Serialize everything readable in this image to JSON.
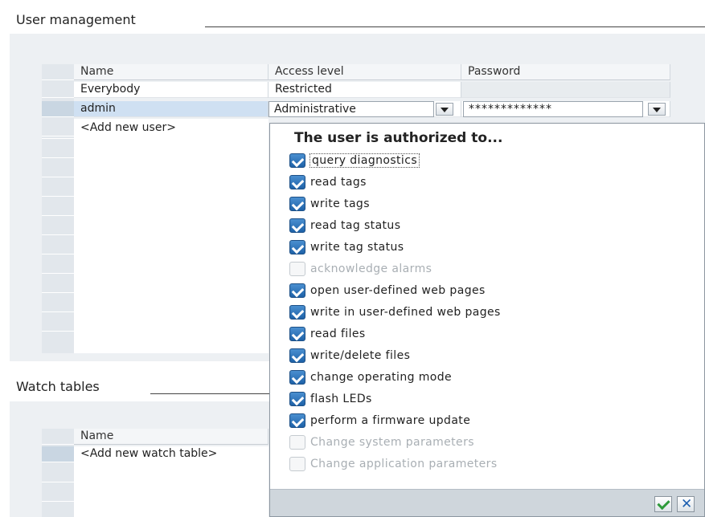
{
  "user_management": {
    "title": "User management",
    "columns": {
      "name": "Name",
      "access_level": "Access level",
      "password": "Password"
    },
    "rows": [
      {
        "name": "Everybody",
        "access_level": "Restricted",
        "password": ""
      },
      {
        "name": "admin",
        "access_level": "Administrative",
        "password": "*************"
      }
    ],
    "add_new": "<Add new user>"
  },
  "watch_tables": {
    "title": "Watch tables",
    "columns": {
      "name": "Name"
    },
    "add_new": "<Add new watch table>"
  },
  "permissions_popup": {
    "title": "The user is authorized to...",
    "items": [
      {
        "label": "query diagnostics",
        "checked": true
      },
      {
        "label": "read tags",
        "checked": true
      },
      {
        "label": "write tags",
        "checked": true
      },
      {
        "label": "read tag status",
        "checked": true
      },
      {
        "label": "write tag status",
        "checked": true
      },
      {
        "label": "acknowledge alarms",
        "checked": false
      },
      {
        "label": "open user-defined web pages",
        "checked": true
      },
      {
        "label": "write in user-defined web pages",
        "checked": true
      },
      {
        "label": "read files",
        "checked": true
      },
      {
        "label": "write/delete files",
        "checked": true
      },
      {
        "label": "change operating mode",
        "checked": true
      },
      {
        "label": "flash LEDs",
        "checked": true
      },
      {
        "label": "perform a firmware update",
        "checked": true
      },
      {
        "label": "Change system parameters",
        "checked": false
      },
      {
        "label": "Change application parameters",
        "checked": false
      }
    ]
  },
  "colors": {
    "selected_row": "#cfe0f2",
    "panel_bg": "#edf0f3",
    "checkbox_checked": "#1e62a8",
    "disabled_text": "#a9afb4"
  },
  "icons": {
    "ok": "green-checkmark-icon",
    "cancel": "blue-x-icon",
    "dropdown": "chevron-down-icon"
  }
}
